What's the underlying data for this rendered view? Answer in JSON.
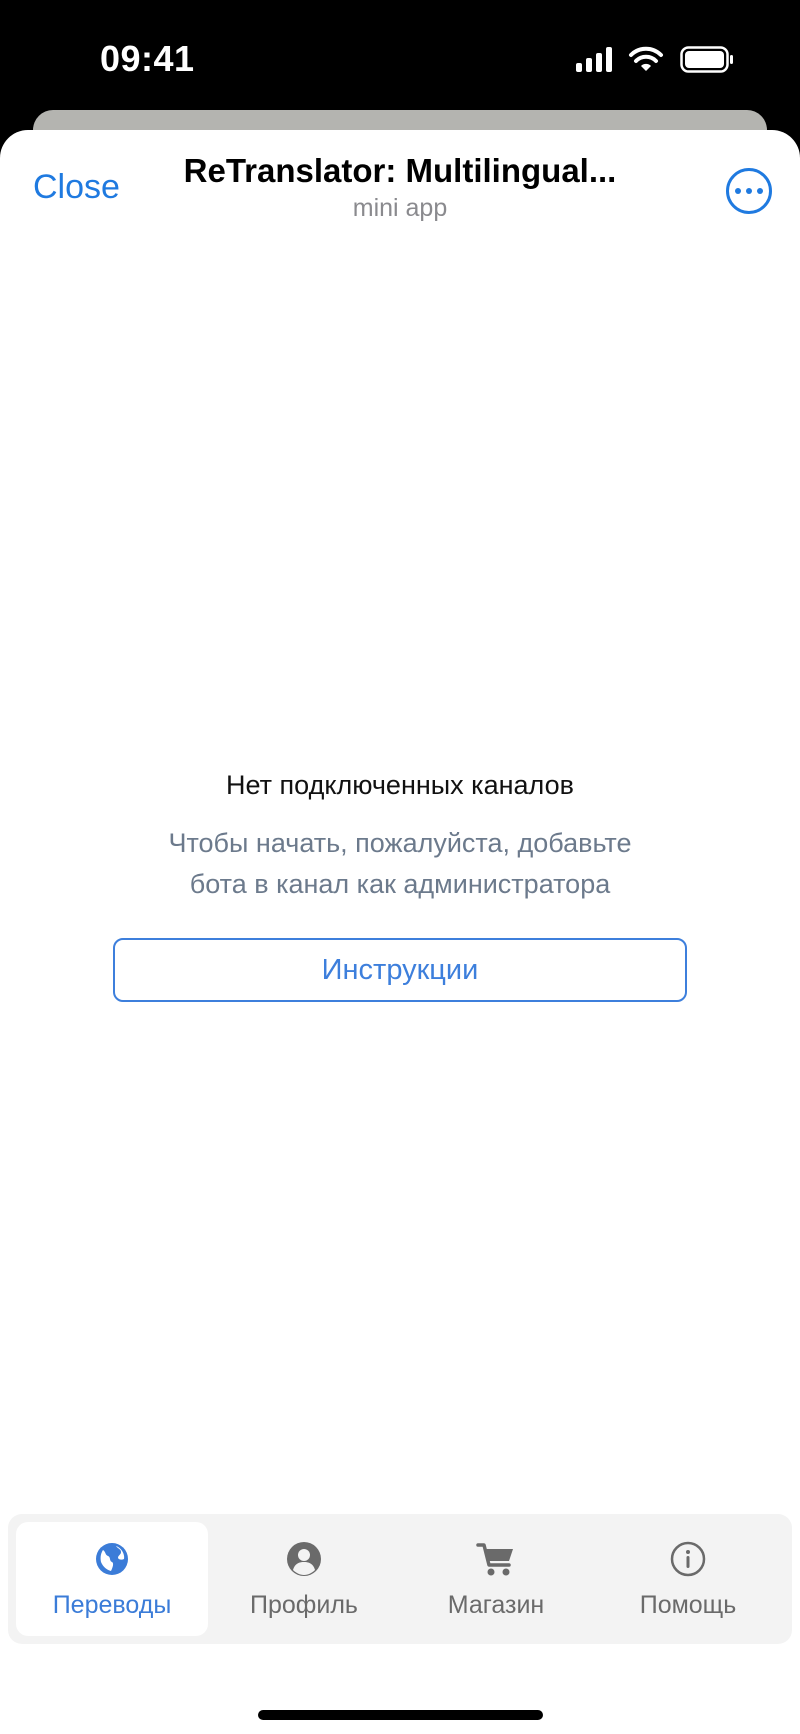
{
  "status_bar": {
    "time": "09:41",
    "icons": [
      "signal-icon",
      "wifi-icon",
      "battery-icon"
    ]
  },
  "header": {
    "close_label": "Close",
    "title": "ReTranslator: Multilingual...",
    "subtitle": "mini app",
    "more_icon": "more-icon"
  },
  "empty_state": {
    "title": "Нет подключенных каналов",
    "line1": "Чтобы начать, пожалуйста, добавьте",
    "line2": "бота в канал как администратора",
    "button_label": "Инструкции"
  },
  "tabs": [
    {
      "label": "Переводы",
      "icon": "globe-icon",
      "active": true
    },
    {
      "label": "Профиль",
      "icon": "user-icon",
      "active": false
    },
    {
      "label": "Магазин",
      "icon": "cart-icon",
      "active": false
    },
    {
      "label": "Помощь",
      "icon": "info-icon",
      "active": false
    }
  ],
  "colors": {
    "accent": "#1f7ae0",
    "tab_active": "#3b7cd8",
    "muted_text": "#6c7a8c"
  }
}
